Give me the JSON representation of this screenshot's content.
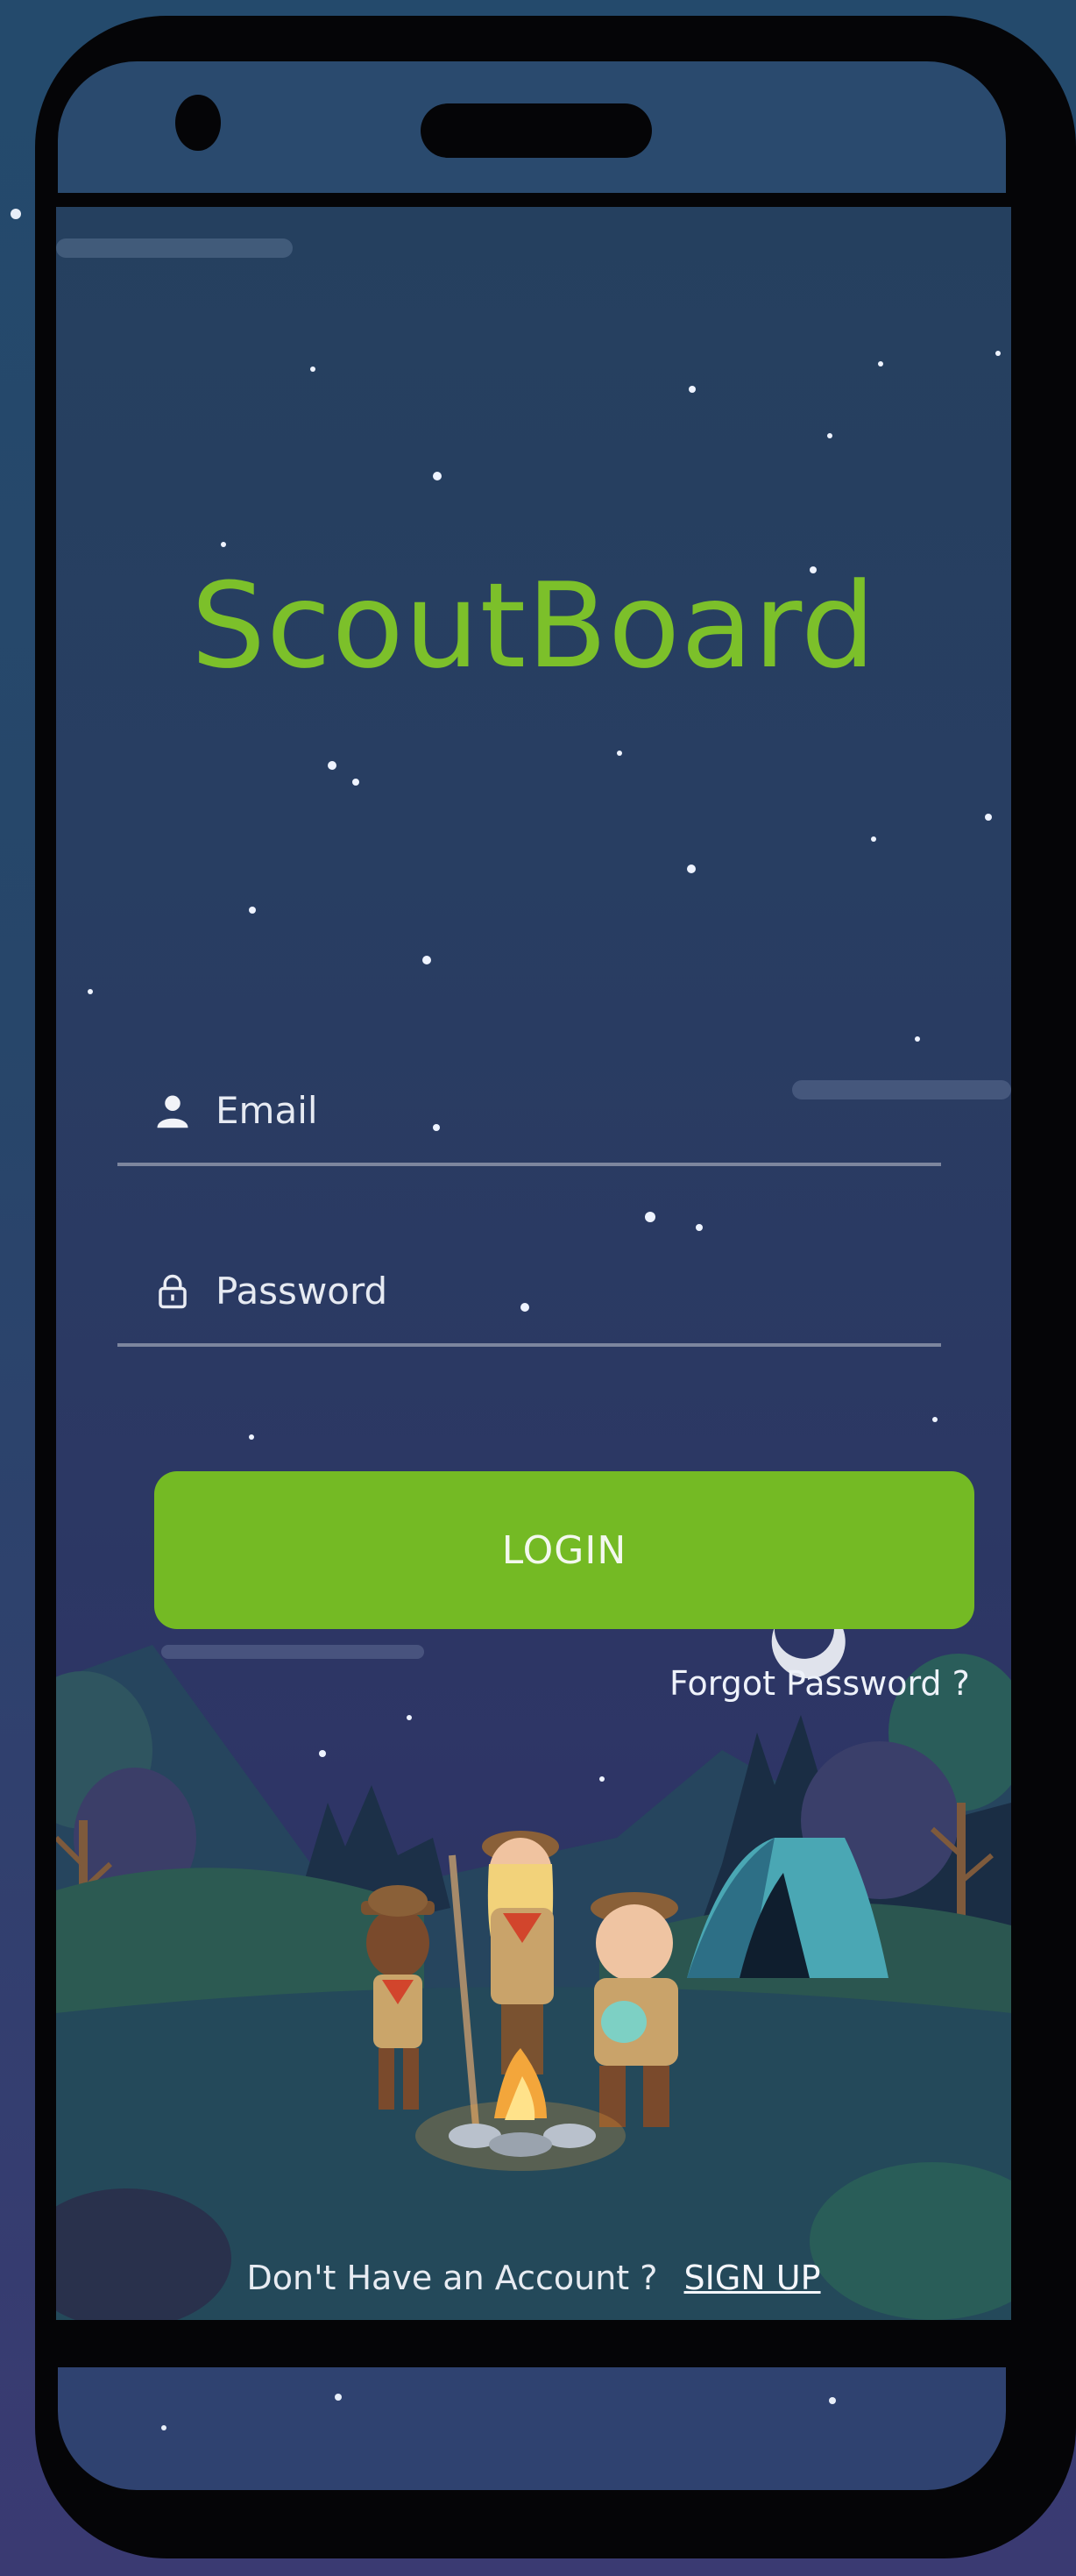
{
  "app": {
    "logo_text": "ScoutBoard"
  },
  "login_form": {
    "email_placeholder": "Email",
    "password_placeholder": "Password",
    "login_label": "LOGIN",
    "forgot_label": "Forgot Password ?"
  },
  "footer": {
    "prompt": "Don't Have an Account ?",
    "signup_label": "SIGN UP"
  },
  "icons": {
    "email": "user-icon",
    "password": "lock-icon"
  },
  "colors": {
    "accent_green": "#74ba24",
    "logo_green": "#7cc02a",
    "screen_bg": "#283e62",
    "device_frame": "#050507"
  }
}
